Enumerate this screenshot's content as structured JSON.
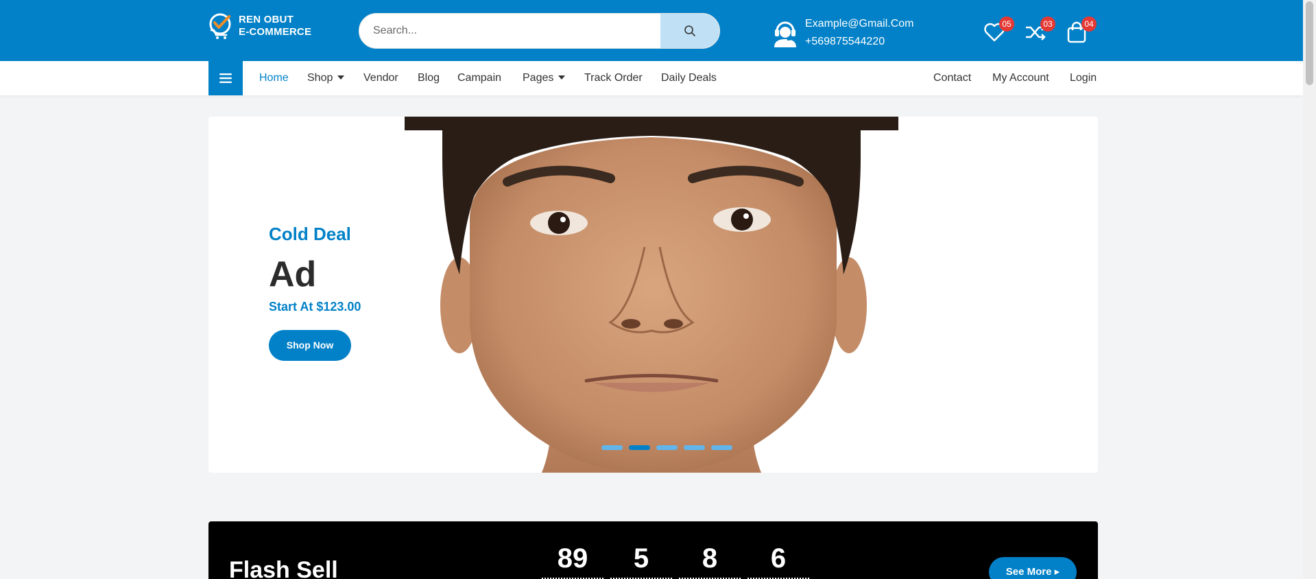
{
  "header": {
    "logo": {
      "line1": "REN OBUT",
      "line2": "E-COMMERCE",
      "icon": "cart-check-logo"
    },
    "search": {
      "placeholder": "Search...",
      "icon": "search-icon"
    },
    "contact": {
      "email": "Example@Gmail.Com",
      "phone": "+569875544220",
      "icon": "headset-user-icon"
    },
    "wishlist": {
      "icon": "heart-icon",
      "count": "05"
    },
    "compare": {
      "icon": "shuffle-icon",
      "count": "03"
    },
    "cart": {
      "icon": "shopping-bag-icon",
      "count": "04"
    }
  },
  "nav": {
    "menu_icon": "hamburger-icon",
    "items": [
      "Home",
      "Shop",
      "Vendor",
      "Blog",
      "Campain",
      "Pages",
      "Track Order",
      "Daily Deals"
    ],
    "right_items": [
      "Contact",
      "My Account",
      "Login"
    ],
    "active": "Home"
  },
  "hero": {
    "subtitle": "Cold Deal",
    "title": "Ad",
    "price": "Start At $123.00",
    "button": "Shop Now",
    "slides": 5,
    "active_slide": 2
  },
  "flash": {
    "title": "Flash Sell",
    "countdown": [
      "89",
      "5",
      "8",
      "6"
    ],
    "button": "See More"
  },
  "colors": {
    "primary": "#0281c8",
    "light": "#bfe0f5",
    "badge": "#e53935",
    "dark": "#000000"
  }
}
